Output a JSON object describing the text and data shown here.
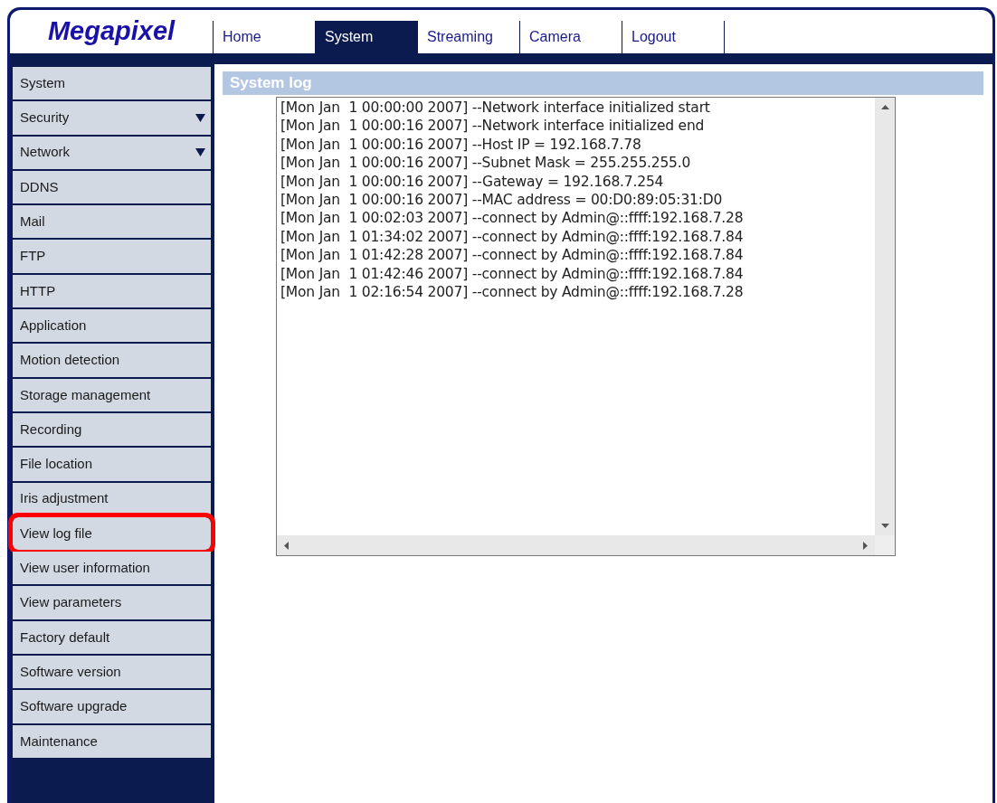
{
  "logo": "Megapixel",
  "tabs": [
    {
      "label": "Home",
      "selected": false
    },
    {
      "label": "System",
      "selected": true
    },
    {
      "label": "Streaming",
      "selected": false
    },
    {
      "label": "Camera",
      "selected": false
    },
    {
      "label": "Logout",
      "selected": false
    }
  ],
  "sidebar": {
    "items": [
      {
        "label": "System",
        "expandable": false,
        "highlighted": false
      },
      {
        "label": "Security",
        "expandable": true,
        "highlighted": false
      },
      {
        "label": "Network",
        "expandable": true,
        "highlighted": false
      },
      {
        "label": "DDNS",
        "expandable": false,
        "highlighted": false
      },
      {
        "label": "Mail",
        "expandable": false,
        "highlighted": false
      },
      {
        "label": "FTP",
        "expandable": false,
        "highlighted": false
      },
      {
        "label": "HTTP",
        "expandable": false,
        "highlighted": false
      },
      {
        "label": "Application",
        "expandable": false,
        "highlighted": false
      },
      {
        "label": "Motion detection",
        "expandable": false,
        "highlighted": false
      },
      {
        "label": "Storage management",
        "expandable": false,
        "highlighted": false
      },
      {
        "label": "Recording",
        "expandable": false,
        "highlighted": false
      },
      {
        "label": "File location",
        "expandable": false,
        "highlighted": false
      },
      {
        "label": "Iris adjustment",
        "expandable": false,
        "highlighted": false
      },
      {
        "label": "View log file",
        "expandable": false,
        "highlighted": true
      },
      {
        "label": "View user information",
        "expandable": false,
        "highlighted": false
      },
      {
        "label": "View parameters",
        "expandable": false,
        "highlighted": false
      },
      {
        "label": "Factory default",
        "expandable": false,
        "highlighted": false
      },
      {
        "label": "Software version",
        "expandable": false,
        "highlighted": false
      },
      {
        "label": "Software upgrade",
        "expandable": false,
        "highlighted": false
      },
      {
        "label": "Maintenance",
        "expandable": false,
        "highlighted": false
      }
    ]
  },
  "panel": {
    "title": "System log",
    "log_lines": [
      "[Mon Jan  1 00:00:00 2007] --Network interface initialized start",
      "[Mon Jan  1 00:00:16 2007] --Network interface initialized end",
      "[Mon Jan  1 00:00:16 2007] --Host IP = 192.168.7.78",
      "[Mon Jan  1 00:00:16 2007] --Subnet Mask = 255.255.255.0",
      "[Mon Jan  1 00:00:16 2007] --Gateway = 192.168.7.254",
      "[Mon Jan  1 00:00:16 2007] --MAC address = 00:D0:89:05:31:D0",
      "[Mon Jan  1 00:02:03 2007] --connect by Admin@::ffff:192.168.7.28",
      "[Mon Jan  1 01:34:02 2007] --connect by Admin@::ffff:192.168.7.84",
      "[Mon Jan  1 01:42:28 2007] --connect by Admin@::ffff:192.168.7.84",
      "[Mon Jan  1 01:42:46 2007] --connect by Admin@::ffff:192.168.7.84",
      "[Mon Jan  1 02:16:54 2007] --connect by Admin@::ffff:192.168.7.28"
    ]
  }
}
